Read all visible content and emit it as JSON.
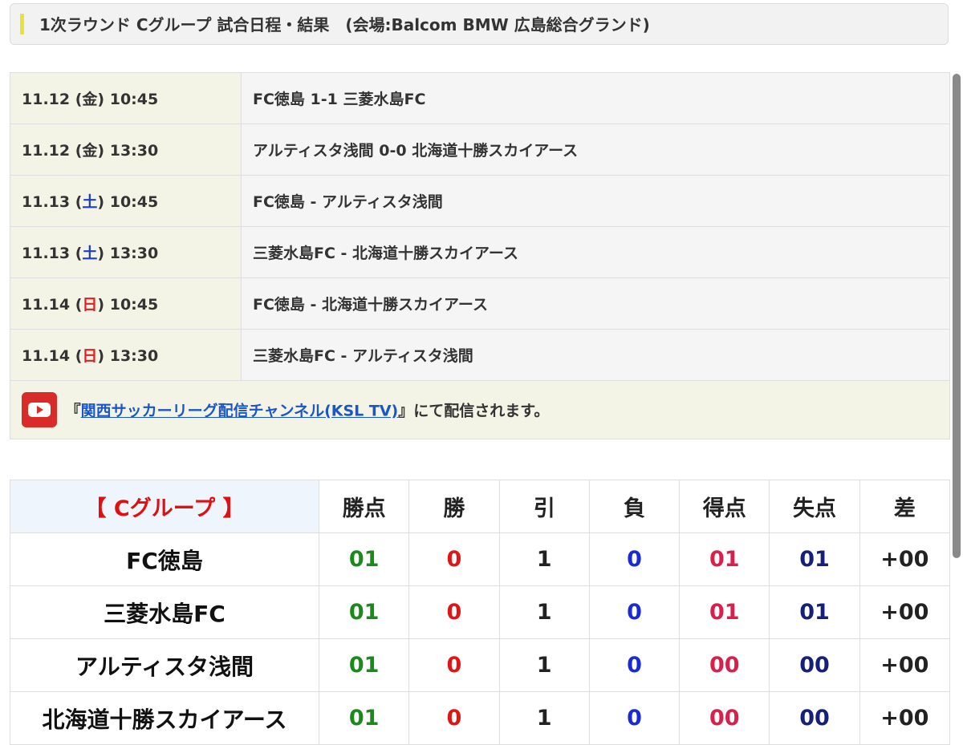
{
  "header": {
    "title": "1次ラウンド Cグループ 試合日程・結果　(会場:Balcom BMW 広島総合グランド)"
  },
  "schedule": [
    {
      "date": "11.12 (",
      "dow": "金",
      "time": ") 10:45",
      "dow_type": "weekday",
      "match": "FC徳島 1-1 三菱水島FC"
    },
    {
      "date": "11.12 (",
      "dow": "金",
      "time": ") 13:30",
      "dow_type": "weekday",
      "match": "アルティスタ浅間 0-0 北海道十勝スカイアース"
    },
    {
      "date": "11.13 (",
      "dow": "土",
      "time": ") 10:45",
      "dow_type": "sat",
      "match": "FC徳島 - アルティスタ浅間"
    },
    {
      "date": "11.13 (",
      "dow": "土",
      "time": ") 13:30",
      "dow_type": "sat",
      "match": "三菱水島FC - 北海道十勝スカイアース"
    },
    {
      "date": "11.14 (",
      "dow": "日",
      "time": ") 10:45",
      "dow_type": "sun",
      "match": "FC徳島 - 北海道十勝スカイアース"
    },
    {
      "date": "11.14 (",
      "dow": "日",
      "time": ") 13:30",
      "dow_type": "sun",
      "match": "三菱水島FC - アルティスタ浅間"
    }
  ],
  "notice": {
    "icon": "youtube-icon",
    "prefix": "『",
    "link": "関西サッカーリーグ配信チャンネル(KSL TV)",
    "suffix": "』にて配信されます。"
  },
  "standings": {
    "group_label": "【 Cグループ 】",
    "columns": [
      "勝点",
      "勝",
      "引",
      "負",
      "得点",
      "失点",
      "差"
    ],
    "rows": [
      {
        "team": "FC徳島",
        "pts": "01",
        "w": "0",
        "d": "1",
        "l": "0",
        "gf": "01",
        "ga": "01",
        "diff": "+00"
      },
      {
        "team": "三菱水島FC",
        "pts": "01",
        "w": "0",
        "d": "1",
        "l": "0",
        "gf": "01",
        "ga": "01",
        "diff": "+00"
      },
      {
        "team": "アルティスタ浅間",
        "pts": "01",
        "w": "0",
        "d": "1",
        "l": "0",
        "gf": "00",
        "ga": "00",
        "diff": "+00"
      },
      {
        "team": "北海道十勝スカイアース",
        "pts": "01",
        "w": "0",
        "d": "1",
        "l": "0",
        "gf": "00",
        "ga": "00",
        "diff": "+00"
      }
    ]
  },
  "colors": {
    "accent_bar": "#e6e23a",
    "saturday": "#1b3fc0",
    "sunday": "#e02020",
    "points": "#1a8a1a",
    "wins": "#e01515",
    "losses": "#1a2ad8",
    "goals_for": "#d8204a",
    "goals_against": "#15207a"
  }
}
